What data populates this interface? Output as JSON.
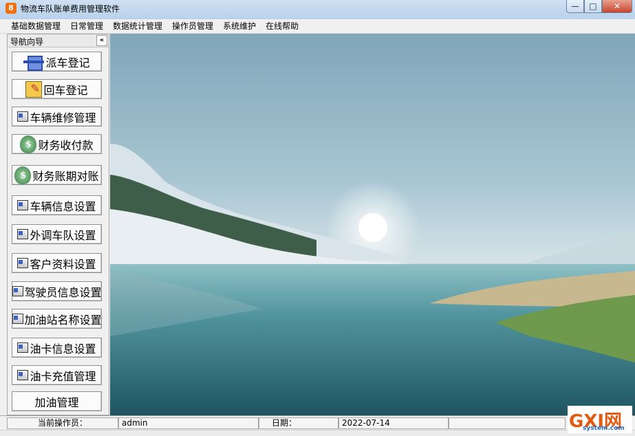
{
  "window": {
    "title": "物流车队账单费用管理软件",
    "app_icon_text": "8",
    "minimize_glyph": "—",
    "maximize_glyph": "□",
    "close_glyph": "✕"
  },
  "menu": [
    "基础数据管理",
    "日常管理",
    "数据统计管理",
    "操作员管理",
    "系统维护",
    "在线帮助"
  ],
  "nav": {
    "title": "导航向导",
    "collapse_glyph": "«",
    "buttons": [
      {
        "label": "派车登记",
        "icon": "truck-icon"
      },
      {
        "label": "回车登记",
        "icon": "note-icon"
      },
      {
        "label": "车辆维修管理",
        "icon": "form-icon"
      },
      {
        "label": "财务收付款",
        "icon": "money-bag-icon"
      },
      {
        "label": "财务账期对账",
        "icon": "money-bag-icon"
      },
      {
        "label": "车辆信息设置",
        "icon": "form-icon"
      },
      {
        "label": "外调车队设置",
        "icon": "form-icon"
      },
      {
        "label": "客户资料设置",
        "icon": "form-icon"
      },
      {
        "label": "驾驶员信息设置",
        "icon": "form-icon"
      },
      {
        "label": "加油站名称设置",
        "icon": "form-icon"
      },
      {
        "label": "油卡信息设置",
        "icon": "form-icon"
      },
      {
        "label": "油卡充值管理",
        "icon": "form-icon"
      },
      {
        "label": "加油管理",
        "icon": ""
      }
    ]
  },
  "status": {
    "operator_label": "当前操作员：",
    "operator_value": "admin",
    "date_label": "日期：",
    "date_value": "2022-07-14"
  },
  "watermark": {
    "logo": "GXI网",
    "url": "system.com"
  }
}
